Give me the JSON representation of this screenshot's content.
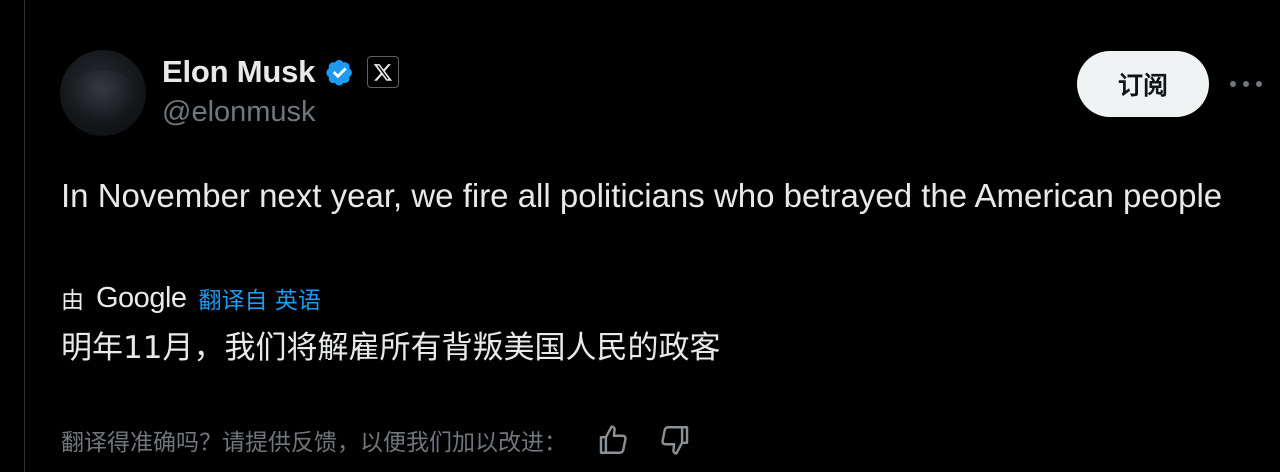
{
  "author": {
    "display_name": "Elon Musk",
    "handle": "@elonmusk"
  },
  "header": {
    "subscribe_label": "订阅"
  },
  "tweet": {
    "text": "In November next year, we fire all politicians who betrayed the American people"
  },
  "translation": {
    "by_label": "由",
    "provider": "Google",
    "translated_from": "翻译自 英语",
    "text": "明年11月，我们将解雇所有背叛美国人民的政客"
  },
  "feedback": {
    "prompt": "翻译得准确吗？请提供反馈，以便我们加以改进："
  },
  "icons": {
    "verified": "verified-badge-icon",
    "affiliate": "x-logo-icon",
    "more": "more-icon",
    "thumbs_up": "thumbs-up-icon",
    "thumbs_down": "thumbs-down-icon"
  },
  "colors": {
    "background": "#000000",
    "text_primary": "#e7e9ea",
    "text_secondary": "#71767b",
    "accent_blue": "#1d9bf0",
    "button_bg": "#eff3f4"
  }
}
